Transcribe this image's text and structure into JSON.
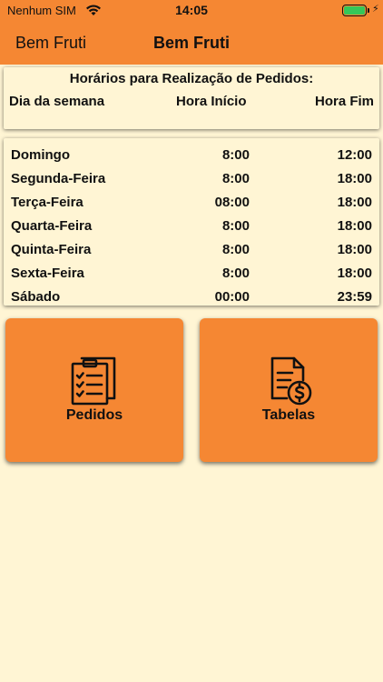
{
  "status_bar": {
    "carrier": "Nenhum SIM",
    "time": "14:05"
  },
  "nav": {
    "back_label": "Bem Fruti",
    "title": "Bem Fruti"
  },
  "schedule_header": {
    "title": "Horários para Realização de Pedidos:",
    "columns": [
      "Dia da semana",
      "Hora Início",
      "Hora Fim"
    ]
  },
  "schedule": [
    {
      "day": "Domingo",
      "start": "8:00",
      "end": "12:00"
    },
    {
      "day": "Segunda-Feira",
      "start": "8:00",
      "end": "18:00"
    },
    {
      "day": "Terça-Feira",
      "start": "08:00",
      "end": "18:00"
    },
    {
      "day": "Quarta-Feira",
      "start": "8:00",
      "end": "18:00"
    },
    {
      "day": "Quinta-Feira",
      "start": "8:00",
      "end": "18:00"
    },
    {
      "day": "Sexta-Feira",
      "start": "8:00",
      "end": "18:00"
    },
    {
      "day": "Sábado",
      "start": "00:00",
      "end": "23:59"
    }
  ],
  "buttons": {
    "pedidos": {
      "label": "Pedidos",
      "icon": "clipboard-checklist-icon"
    },
    "tabelas": {
      "label": "Tabelas",
      "icon": "document-dollar-icon"
    }
  },
  "colors": {
    "accent": "#f58733",
    "background": "#fff5d4",
    "battery": "#35c759"
  }
}
